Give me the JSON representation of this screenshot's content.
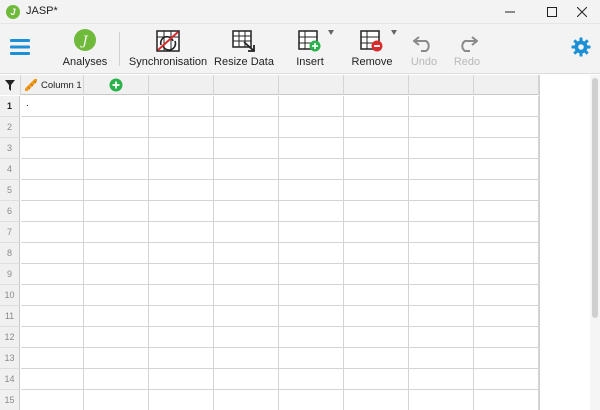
{
  "window": {
    "title": "JASP*"
  },
  "toolbar": {
    "analyses_label": "Analyses",
    "sync_label": "Synchronisation",
    "resize_label": "Resize Data",
    "insert_label": "Insert",
    "remove_label": "Remove",
    "undo_label": "Undo",
    "redo_label": "Redo"
  },
  "grid": {
    "column_header": "Column 1",
    "first_cell_value": ".",
    "row_numbers": [
      "1",
      "2",
      "3",
      "4",
      "5",
      "6",
      "7",
      "8",
      "9",
      "10",
      "11",
      "12",
      "13",
      "14",
      "15"
    ]
  },
  "colors": {
    "accent_blue": "#1b8fd6",
    "add_green": "#2bb24c",
    "remove_red": "#d92b2b",
    "analyses_green": "#6fba3a"
  }
}
